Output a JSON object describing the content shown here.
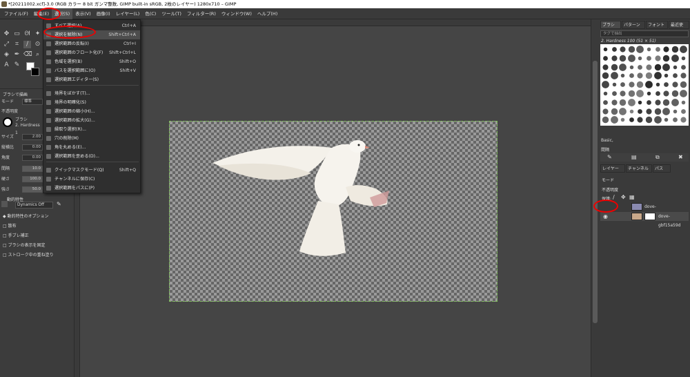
{
  "titlebar": {
    "text": "*[20211002.xcf]-3.0 (RGB カラー 8 bit ガンマ整数, GIMP built-in sRGB, 2枚のレイヤー) 1280x710 – GIMP"
  },
  "menubar": [
    {
      "label": "ファイル(F)"
    },
    {
      "label": "編集(E)"
    },
    {
      "label": "選択(S)"
    },
    {
      "label": "表示(V)"
    },
    {
      "label": "画像(I)"
    },
    {
      "label": "レイヤー(L)"
    },
    {
      "label": "色(C)"
    },
    {
      "label": "ツール(T)"
    },
    {
      "label": "フィルター(R)"
    },
    {
      "label": "ウィンドウ(W)"
    },
    {
      "label": "ヘルプ(H)"
    }
  ],
  "dropdown": {
    "items": [
      {
        "label": "すべて選択(A)",
        "shortcut": "Ctrl+A"
      },
      {
        "label": "選択を解除(N)",
        "shortcut": "Shift+Ctrl+A"
      },
      {
        "label": "選択範囲の反転(I)",
        "shortcut": "Ctrl+I"
      },
      {
        "label": "選択範囲のフロート化(F)",
        "shortcut": "Shift+Ctrl+L"
      },
      {
        "label": "色域を選択(B)",
        "shortcut": "Shift+O"
      },
      {
        "label": "パスを選択範囲に(O)",
        "shortcut": "Shift+V"
      },
      {
        "label": "選択範囲エディター(S)",
        "shortcut": ""
      },
      {
        "label": "境界をぼかす(T)...",
        "shortcut": ""
      },
      {
        "label": "境界の明確化(S)",
        "shortcut": ""
      },
      {
        "label": "選択範囲の縮小(H)...",
        "shortcut": ""
      },
      {
        "label": "選択範囲の拡大(G)...",
        "shortcut": ""
      },
      {
        "label": "縁取り選択(R)...",
        "shortcut": ""
      },
      {
        "label": "穴の削除(M)",
        "shortcut": ""
      },
      {
        "label": "角を丸める(E)...",
        "shortcut": ""
      },
      {
        "label": "選択範囲を歪める(D)...",
        "shortcut": ""
      },
      {
        "label": "クイックマスクモード(Q)",
        "shortcut": "Shift+Q"
      },
      {
        "label": "チャンネルに保存(C)",
        "shortcut": ""
      },
      {
        "label": "選択範囲をパスに(P)",
        "shortcut": ""
      }
    ]
  },
  "tool_options": {
    "header": "ブラシで描画",
    "mode_label": "モード",
    "mode_value": "標準",
    "opacity_label": "不透明度",
    "brush_label": "ブラシ",
    "brush_value": "2. Hardness 1",
    "size_label": "サイズ",
    "size_value": "2.00",
    "aspect_label": "縦横比",
    "aspect_value": "0.00",
    "angle_label": "角度",
    "angle_value": "0.00",
    "spacing_label": "間隔",
    "spacing_value": "10.0",
    "hardness_label": "硬さ",
    "hardness_value": "100.0",
    "force_label": "強さ",
    "force_value": "50.0",
    "dynamics_label": "動的特性",
    "dynamics_value": "Dynamics Off",
    "dynamics_options": "動的特性のオプション",
    "scatter": "散布",
    "smooth": "手ブレ補正",
    "lock_brush": "ブラシの表示を固定",
    "incremental": "ストローク中の重ね塗り"
  },
  "dock": {
    "tabs": [
      "ブラシ",
      "パターン",
      "フォント",
      "最近使"
    ],
    "filter_placeholder": "タグで抽出",
    "brush_name": "2. Hardness 100 (51 × 51)",
    "brush_set": "Basic,",
    "spacing_label": "間隔",
    "layer_tabs": [
      "レイヤー",
      "チャンネル",
      "パス"
    ],
    "mode_label": "モード",
    "opacity_label": "不透明度",
    "lock_label": "保護:",
    "layers": [
      {
        "name": "dove-gbf15a59d7_1280"
      },
      {
        "name": "dove-gbf15a59d"
      }
    ]
  },
  "colors": {
    "fg": "#ffffff",
    "bg": "#000000",
    "annotation": "#e00000",
    "selection_border": "#7fbf5a"
  }
}
